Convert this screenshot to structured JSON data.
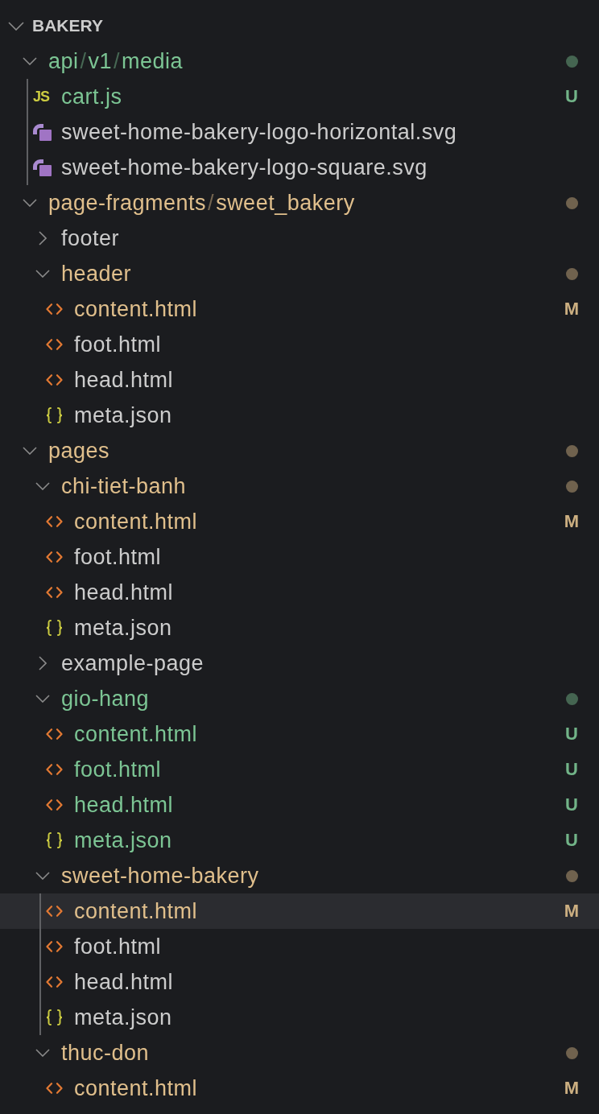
{
  "explorer": {
    "title": "BAKERY",
    "expanded": true,
    "items": [
      {
        "kind": "folder",
        "label": "api/v1/media",
        "expanded": true,
        "selected": false,
        "color": "#7cc594",
        "dot": true,
        "indent_guide": true,
        "children": [
          {
            "kind": "js",
            "icon": "JS",
            "label": "cart.js",
            "selected": false,
            "color": "#7cc594",
            "badge": "U"
          },
          {
            "kind": "svg",
            "label": "sweet-home-bakery-logo-horizontal.svg",
            "selected": false,
            "color": "#cccccc"
          },
          {
            "kind": "svg",
            "label": "sweet-home-bakery-logo-square.svg",
            "selected": false,
            "color": "#cccccc"
          }
        ]
      },
      {
        "kind": "folder",
        "label": "page-fragments/sweet_bakery",
        "expanded": true,
        "selected": false,
        "color": "#e0bf8c",
        "dot": true,
        "indent_guide": false,
        "children": [
          {
            "kind": "folder",
            "label": "footer",
            "expanded": false,
            "selected": false,
            "color": "#cccccc",
            "dot": false
          },
          {
            "kind": "folder",
            "label": "header",
            "expanded": true,
            "selected": false,
            "color": "#e0bf8c",
            "dot": true,
            "indent_guide": false,
            "children": [
              {
                "kind": "html",
                "label": "content.html",
                "selected": false,
                "color": "#e0bf8c",
                "badge": "M"
              },
              {
                "kind": "html",
                "label": "foot.html",
                "selected": false,
                "color": "#cccccc"
              },
              {
                "kind": "html",
                "label": "head.html",
                "selected": false,
                "color": "#cccccc"
              },
              {
                "kind": "json",
                "label": "meta.json",
                "selected": false,
                "color": "#cccccc"
              }
            ]
          }
        ]
      },
      {
        "kind": "folder",
        "label": "pages",
        "expanded": true,
        "selected": false,
        "color": "#e0bf8c",
        "dot": true,
        "indent_guide": false,
        "children": [
          {
            "kind": "folder",
            "label": "chi-tiet-banh",
            "expanded": true,
            "selected": false,
            "color": "#e0bf8c",
            "dot": true,
            "indent_guide": false,
            "children": [
              {
                "kind": "html",
                "label": "content.html",
                "selected": false,
                "color": "#e0bf8c",
                "badge": "M"
              },
              {
                "kind": "html",
                "label": "foot.html",
                "selected": false,
                "color": "#cccccc"
              },
              {
                "kind": "html",
                "label": "head.html",
                "selected": false,
                "color": "#cccccc"
              },
              {
                "kind": "json",
                "label": "meta.json",
                "selected": false,
                "color": "#cccccc"
              }
            ]
          },
          {
            "kind": "folder",
            "label": "example-page",
            "expanded": false,
            "selected": false,
            "color": "#cccccc",
            "dot": false
          },
          {
            "kind": "folder",
            "label": "gio-hang",
            "expanded": true,
            "selected": false,
            "color": "#7cc594",
            "dot": true,
            "indent_guide": false,
            "children": [
              {
                "kind": "html",
                "label": "content.html",
                "selected": false,
                "color": "#7cc594",
                "badge": "U"
              },
              {
                "kind": "html",
                "label": "foot.html",
                "selected": false,
                "color": "#7cc594",
                "badge": "U"
              },
              {
                "kind": "html",
                "label": "head.html",
                "selected": false,
                "color": "#7cc594",
                "badge": "U"
              },
              {
                "kind": "json",
                "label": "meta.json",
                "selected": false,
                "color": "#7cc594",
                "badge": "U"
              }
            ]
          },
          {
            "kind": "folder",
            "label": "sweet-home-bakery",
            "expanded": true,
            "selected": false,
            "color": "#e0bf8c",
            "dot": true,
            "indent_guide": true,
            "children": [
              {
                "kind": "html",
                "label": "content.html",
                "selected": true,
                "color": "#e0bf8c",
                "badge": "M"
              },
              {
                "kind": "html",
                "label": "foot.html",
                "selected": false,
                "color": "#cccccc"
              },
              {
                "kind": "html",
                "label": "head.html",
                "selected": false,
                "color": "#cccccc"
              },
              {
                "kind": "json",
                "label": "meta.json",
                "selected": false,
                "color": "#cccccc"
              }
            ]
          },
          {
            "kind": "folder",
            "label": "thuc-don",
            "expanded": true,
            "selected": false,
            "color": "#e0bf8c",
            "dot": true,
            "indent_guide": false,
            "children": [
              {
                "kind": "html",
                "label": "content.html",
                "selected": false,
                "color": "#e0bf8c",
                "badge": "M"
              }
            ]
          }
        ]
      }
    ]
  }
}
